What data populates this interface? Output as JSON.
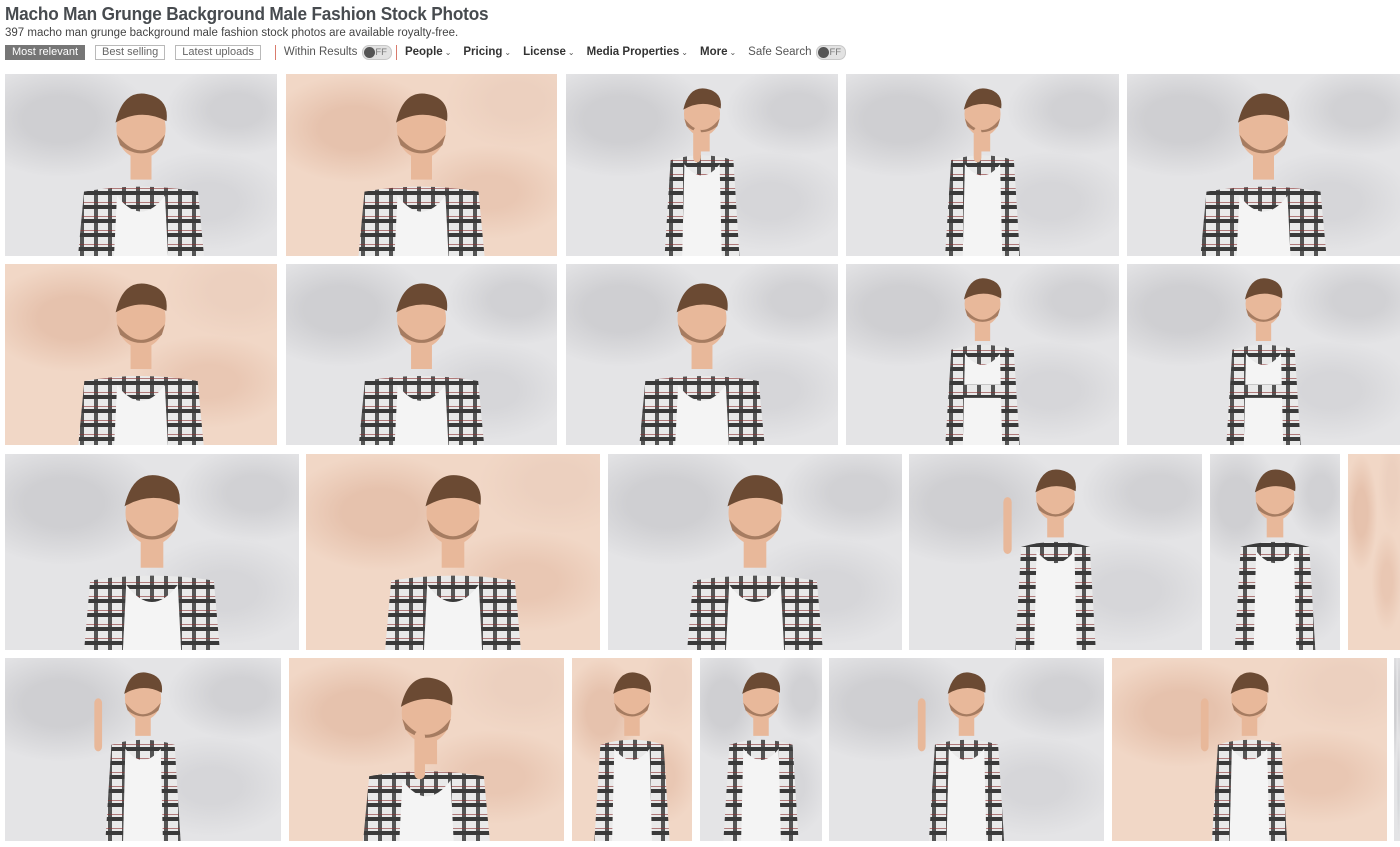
{
  "header": {
    "title": "Macho Man Grunge Background Male Fashion Stock Photos",
    "subtitle": "397 macho man grunge background male fashion stock photos are available royalty-free."
  },
  "filters": {
    "sort": [
      "Most relevant",
      "Best selling",
      "Latest uploads"
    ],
    "within_results": {
      "label": "Within Results",
      "state": "FF"
    },
    "dropdowns": [
      "People",
      "Pricing",
      "License",
      "Media Properties",
      "More"
    ],
    "safe_search": {
      "label": "Safe Search",
      "state": "FF"
    }
  },
  "colors": {
    "accent_separator": "#d97b6c",
    "active_sort": "#767676"
  },
  "icons": {
    "dropdown": "chevron-down-icon",
    "toggle": "toggle-switch-icon"
  },
  "photos": [
    {
      "bg": "gray",
      "pose": "collar"
    },
    {
      "bg": "peach",
      "pose": "collar"
    },
    {
      "bg": "gray",
      "pose": "thinking"
    },
    {
      "bg": "gray",
      "pose": "shush"
    },
    {
      "bg": "gray",
      "pose": "closeup"
    },
    {
      "bg": "peach",
      "pose": "closeup"
    },
    {
      "bg": "gray",
      "pose": "closeup"
    },
    {
      "bg": "gray",
      "pose": "collar"
    },
    {
      "bg": "gray",
      "pose": "arms-crossed"
    },
    {
      "bg": "gray",
      "pose": "arms-crossed"
    },
    {
      "bg": "gray",
      "pose": "smile"
    },
    {
      "bg": "peach",
      "pose": "smile"
    },
    {
      "bg": "gray",
      "pose": "smile"
    },
    {
      "bg": "gray",
      "pose": "pointing"
    },
    {
      "bg": "gray",
      "pose": "standing"
    },
    {
      "bg": "peach",
      "pose": "cropped"
    },
    {
      "bg": "gray",
      "pose": "thumb"
    },
    {
      "bg": "peach",
      "pose": "chin"
    },
    {
      "bg": "peach",
      "pose": "standing"
    },
    {
      "bg": "gray",
      "pose": "standing"
    },
    {
      "bg": "gray",
      "pose": "thumb"
    },
    {
      "bg": "peach",
      "pose": "thumb"
    },
    {
      "bg": "gray",
      "pose": "cropped"
    }
  ]
}
